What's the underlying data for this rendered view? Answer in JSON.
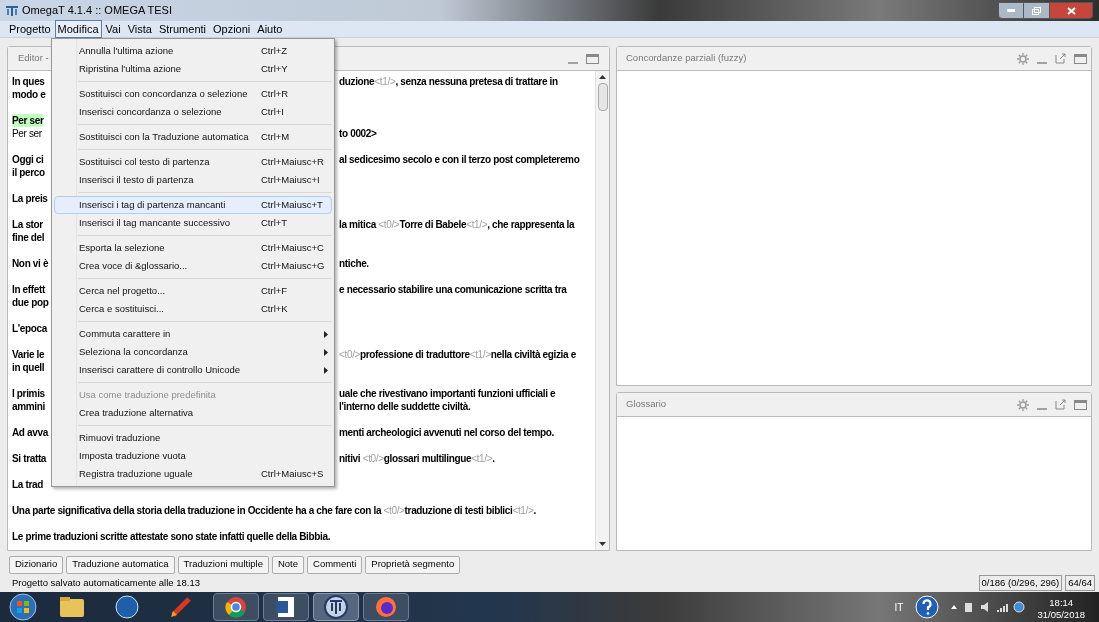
{
  "window": {
    "title": "OmegaT 4.1.4 :: OMEGA TESI"
  },
  "menubar": [
    {
      "label": "Progetto",
      "selected": false
    },
    {
      "label": "Modifica",
      "selected": true
    },
    {
      "label": "Vai",
      "selected": false
    },
    {
      "label": "Vista",
      "selected": false
    },
    {
      "label": "Strumenti",
      "selected": false
    },
    {
      "label": "Opzioni",
      "selected": false
    },
    {
      "label": "Aiuto",
      "selected": false
    }
  ],
  "menu": {
    "groups": [
      [
        {
          "label": "Annulla l'ultima azione",
          "shortcut": "Ctrl+Z",
          "has_submenu": false,
          "disabled": false,
          "selected": false
        },
        {
          "label": "Ripristina l'ultima azione",
          "shortcut": "Ctrl+Y",
          "has_submenu": false,
          "disabled": false,
          "selected": false
        }
      ],
      [
        {
          "label": "Sostituisci con concordanza o selezione",
          "shortcut": "Ctrl+R",
          "has_submenu": false,
          "disabled": false,
          "selected": false
        },
        {
          "label": "Inserisci concordanza o selezione",
          "shortcut": "Ctrl+I",
          "has_submenu": false,
          "disabled": false,
          "selected": false
        }
      ],
      [
        {
          "label": "Sostituisci con la Traduzione automatica",
          "shortcut": "Ctrl+M",
          "has_submenu": false,
          "disabled": false,
          "selected": false
        }
      ],
      [
        {
          "label": "Sostituisci col testo di partenza",
          "shortcut": "Ctrl+Maiusc+R",
          "has_submenu": false,
          "disabled": false,
          "selected": false
        },
        {
          "label": "Inserisci il testo di partenza",
          "shortcut": "Ctrl+Maiusc+I",
          "has_submenu": false,
          "disabled": false,
          "selected": false
        }
      ],
      [
        {
          "label": "Inserisci i tag di partenza mancanti",
          "shortcut": "Ctrl+Maiusc+T",
          "has_submenu": false,
          "disabled": false,
          "selected": true
        },
        {
          "label": "Inserisci il tag mancante successivo",
          "shortcut": "Ctrl+T",
          "has_submenu": false,
          "disabled": false,
          "selected": false
        }
      ],
      [
        {
          "label": "Esporta la selezione",
          "shortcut": "Ctrl+Maiusc+C",
          "has_submenu": false,
          "disabled": false,
          "selected": false
        },
        {
          "label": "Crea voce di &glossario...",
          "shortcut": "Ctrl+Maiusc+G",
          "has_submenu": false,
          "disabled": false,
          "selected": false
        }
      ],
      [
        {
          "label": "Cerca nel progetto...",
          "shortcut": "Ctrl+F",
          "has_submenu": false,
          "disabled": false,
          "selected": false
        },
        {
          "label": "Cerca e sostituisci...",
          "shortcut": "Ctrl+K",
          "has_submenu": false,
          "disabled": false,
          "selected": false
        }
      ],
      [
        {
          "label": "Commuta carattere in",
          "has_submenu": true,
          "disabled": false,
          "selected": false
        },
        {
          "label": "Seleziona la concordanza",
          "has_submenu": true,
          "disabled": false,
          "selected": false
        },
        {
          "label": "Inserisci carattere di controllo Unicode",
          "has_submenu": true,
          "disabled": false,
          "selected": false
        }
      ],
      [
        {
          "label": "Usa come traduzione predefinita",
          "has_submenu": false,
          "disabled": true,
          "selected": false
        },
        {
          "label": "Crea traduzione alternativa",
          "has_submenu": false,
          "disabled": false,
          "selected": false
        }
      ],
      [
        {
          "label": "Rimuovi traduzione",
          "has_submenu": false,
          "disabled": false,
          "selected": false
        },
        {
          "label": "Imposta traduzione vuota",
          "has_submenu": false,
          "disabled": false,
          "selected": false
        },
        {
          "label": "Registra traduzione uguale",
          "shortcut": "Ctrl+Maiusc+S",
          "has_submenu": false,
          "disabled": false,
          "selected": false
        }
      ]
    ]
  },
  "editor": {
    "title": "Editor -",
    "paragraphs": [
      [
        {
          "left": "In ques",
          "right": "duzione<t1/>, senza nessuna pretesa di trattare in"
        },
        {
          "left": "modo e"
        }
      ],
      [
        {
          "left": "Per ser",
          "active": true
        },
        {
          "left": "Per ser",
          "right": "to 0002>",
          "target": true
        }
      ],
      [
        {
          "left": "Oggi ci",
          "right": "al sedicesimo secolo e con il terzo post completeremo"
        },
        {
          "left": "il perco"
        }
      ],
      [
        {
          "left": "La preis"
        }
      ],
      [
        {
          "left": "La stor",
          "right": "la mitica <t0/>Torre di Babele<t1/>, che rappresenta la"
        },
        {
          "left": "fine del"
        }
      ],
      [
        {
          "left": "Non vi è",
          "right": "ntiche."
        }
      ],
      [
        {
          "left": "In effett",
          "right": "e necessario stabilire una comunicazione scritta tra"
        },
        {
          "left": "due pop"
        }
      ],
      [
        {
          "left": "L'epoca"
        }
      ],
      [
        {
          "left": "Varie le",
          "right": "<t0/>professione di traduttore<t1/>nella civiltà egizia e"
        },
        {
          "left": "in quell"
        }
      ],
      [
        {
          "left": "I primis",
          "right": "uale che rivestivano importanti funzioni ufficiali e"
        },
        {
          "left": "ammini",
          "right": "l'interno delle suddette civiltà."
        }
      ],
      [
        {
          "left": "Ad avva",
          "right": "menti archeologici avvenuti nel corso del tempo."
        }
      ],
      [
        {
          "left": "Si tratta",
          "right": "nitivi <t0/>glossari multilingue<t1/>."
        }
      ],
      [
        {
          "left": "La trad"
        }
      ],
      [
        {
          "full": "Una parte significativa della storia della traduzione in Occidente ha a che fare con la <t0/>traduzione di testi biblici<t1/>."
        }
      ],
      [
        {
          "full": "Le prime traduzioni scritte attestate sono state infatti quelle della Bibbia."
        }
      ]
    ]
  },
  "panels": [
    {
      "title": "Concordanze parziali (fuzzy)"
    },
    {
      "title": "Glossario"
    }
  ],
  "bottom_tabs": [
    "Dizionario",
    "Traduzione automatica",
    "Traduzioni multiple",
    "Note",
    "Commenti",
    "Proprietà segmento"
  ],
  "status_bar": {
    "message": "Progetto salvato automaticamente alle 18.13",
    "progress": "0/186 (0/296, 296)",
    "segments": "64/64"
  },
  "taskbar": {
    "language": "IT",
    "time": "18:14",
    "date": "31/05/2018"
  }
}
